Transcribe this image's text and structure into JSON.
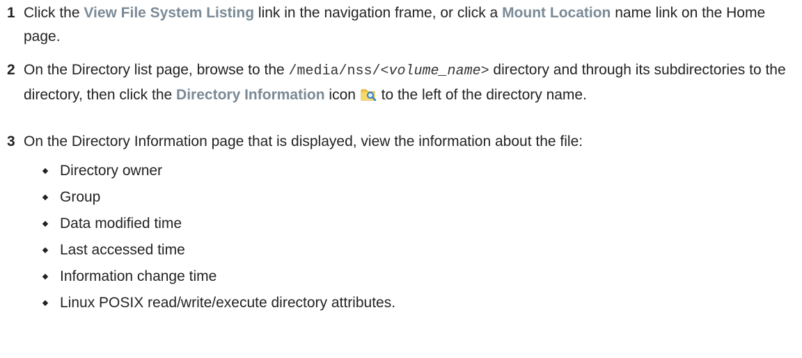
{
  "steps": [
    {
      "number": "1",
      "t1": "Click the ",
      "link1": "View File System Listing",
      "t2": " link in the navigation frame, or click a ",
      "link2": "Mount Location",
      "t3": " name link on the Home page."
    },
    {
      "number": "2",
      "t1": "On the Directory list page, browse to the ",
      "path_prefix": "/media/nss/<",
      "path_var": "volume_name",
      "path_suffix": ">",
      "t2": " directory and through its subdirectories to the directory, then click the ",
      "link1": "Directory Information",
      "t3": " icon ",
      "icon": "folder-magnifier-icon",
      "t4": " to the left of the directory name."
    },
    {
      "number": "3",
      "t1": "On the Directory Information page that is displayed, view the information about the file:"
    }
  ],
  "bullets": [
    "Directory owner",
    "Group",
    "Data modified time",
    "Last accessed time",
    "Information change time",
    "Linux POSIX read/write/execute directory attributes."
  ],
  "colors": {
    "ui_term": "#7a8a96",
    "text": "#222222",
    "folder": "#f2c94c",
    "magnifier": "#2f7fc1"
  }
}
